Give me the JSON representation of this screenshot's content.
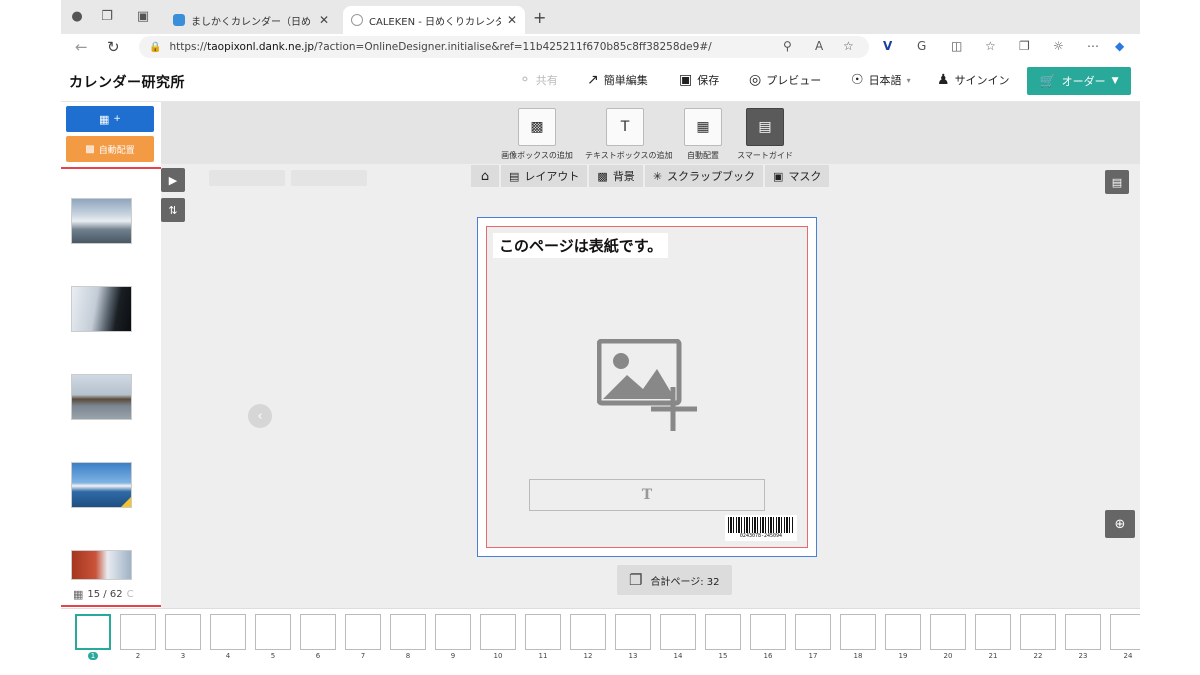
{
  "browser": {
    "tabs": [
      {
        "title": "ましかくカレンダー（日めくり） -",
        "active": false
      },
      {
        "title": "CALEKEN - 日めくりカレンダーを",
        "active": true
      }
    ],
    "url_prefix": "https://",
    "url_host": "taopixonl.dank.ne.jp",
    "url_path": "/?action=OnlineDesigner.initialise&ref=11b425211f670b85c8ff38258de9#/"
  },
  "header": {
    "logo": "カレンダー研究所",
    "share": "共有",
    "easy_edit": "簡単編集",
    "save": "保存",
    "preview": "プレビュー",
    "language": "日本語",
    "signin": "サインイン",
    "order": "オーダー"
  },
  "left_panel": {
    "add_photo_label": "+",
    "auto_place_label": "自動配置",
    "photo_count": "15 / 62",
    "thumbnails": [
      "glacier-photo",
      "snow-mountain-photo",
      "sign-gate-photo",
      "cruise-ship-photo",
      "red-building-photo"
    ]
  },
  "toolbar": {
    "tools": [
      {
        "label": "画像ボックスの追加",
        "icon": "image-box-icon"
      },
      {
        "label": "テキストボックスの追加",
        "icon": "text-box-icon"
      },
      {
        "label": "自動配置",
        "icon": "auto-place-icon"
      },
      {
        "label": "スマートガイド",
        "icon": "smart-guide-icon"
      }
    ]
  },
  "editor_tabs": [
    {
      "label": "レイアウト",
      "icon": "layout-icon"
    },
    {
      "label": "背景",
      "icon": "background-icon"
    },
    {
      "label": "スクラップブック",
      "icon": "scrapbook-icon"
    },
    {
      "label": "マスク",
      "icon": "mask-icon"
    }
  ],
  "page": {
    "cover_text": "このページは表紙です。",
    "text_placeholder": "T",
    "barcode_number": "0243078-245094"
  },
  "total_pages": "合計ページ: 32",
  "page_strip": {
    "numbers": [
      "1",
      "2",
      "3",
      "4",
      "5",
      "6",
      "7",
      "8",
      "9",
      "10",
      "11",
      "12",
      "13",
      "14",
      "15",
      "16",
      "17",
      "18",
      "19",
      "20",
      "21",
      "22",
      "23",
      "24"
    ],
    "selected_index": 0
  },
  "colors": {
    "accent": "#29a99a",
    "primary_blue": "#1e6fd0",
    "orange": "#f29a44",
    "highlight_red": "#e8434a"
  }
}
